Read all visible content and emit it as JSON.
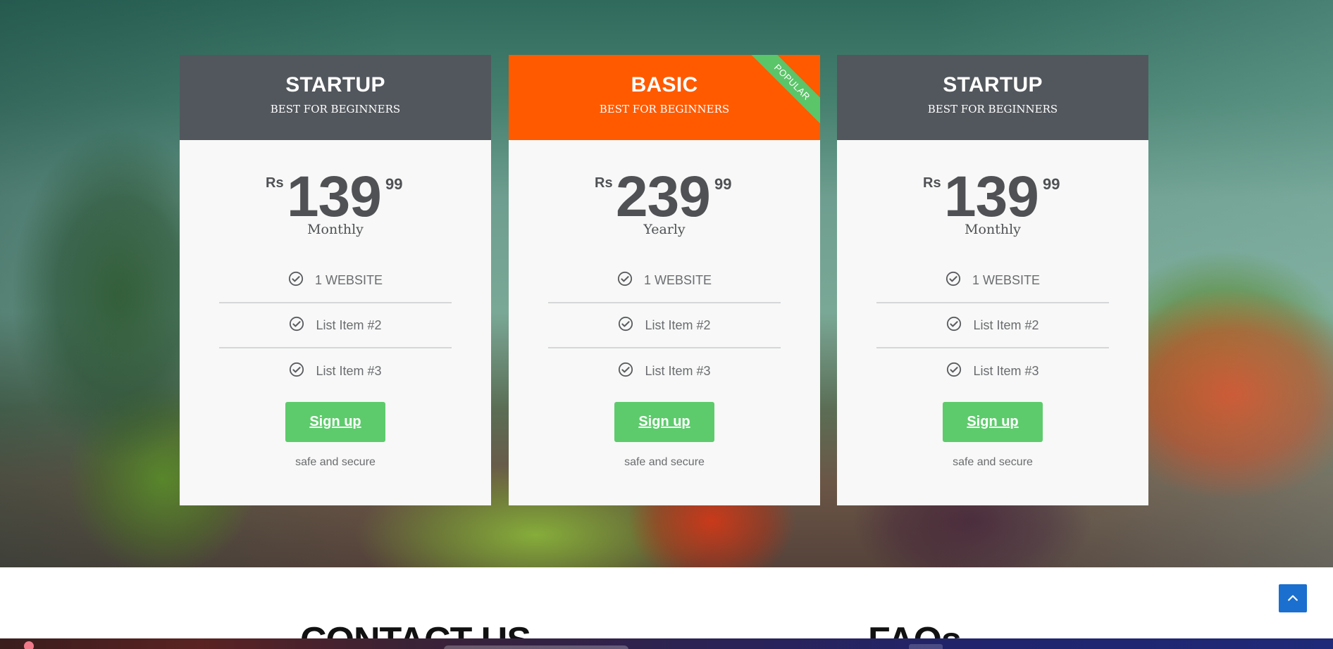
{
  "colors": {
    "card_header": "#52575d",
    "featured_header": "#ff5a00",
    "ribbon": "#5bc569",
    "button": "#5dcb6c",
    "scroll_top": "#1b6fce"
  },
  "plans": [
    {
      "name": "STARTUP",
      "subtitle": "BEST FOR BEGINNERS",
      "currency": "Rs",
      "amount": "139",
      "cents": "99",
      "period": "Monthly",
      "features": [
        "1 WEBSITE",
        "List Item #2",
        "List Item #3"
      ],
      "cta": "Sign up",
      "note": "safe and secure"
    },
    {
      "name": "BASIC",
      "subtitle": "BEST FOR BEGINNERS",
      "badge": "POPULAR",
      "currency": "Rs",
      "amount": "239",
      "cents": "99",
      "period": "Yearly",
      "features": [
        "1 WEBSITE",
        "List Item #2",
        "List Item #3"
      ],
      "cta": "Sign up",
      "note": "safe and secure"
    },
    {
      "name": "STARTUP",
      "subtitle": "BEST FOR BEGINNERS",
      "currency": "Rs",
      "amount": "139",
      "cents": "99",
      "period": "Monthly",
      "features": [
        "1 WEBSITE",
        "List Item #2",
        "List Item #3"
      ],
      "cta": "Sign up",
      "note": "safe and secure"
    }
  ],
  "sections": {
    "contact_heading": "CONTACT US",
    "faq_heading": "FAQs"
  },
  "icons": {
    "feature": "check-circle-icon",
    "scroll_top": "chevron-up-icon"
  }
}
